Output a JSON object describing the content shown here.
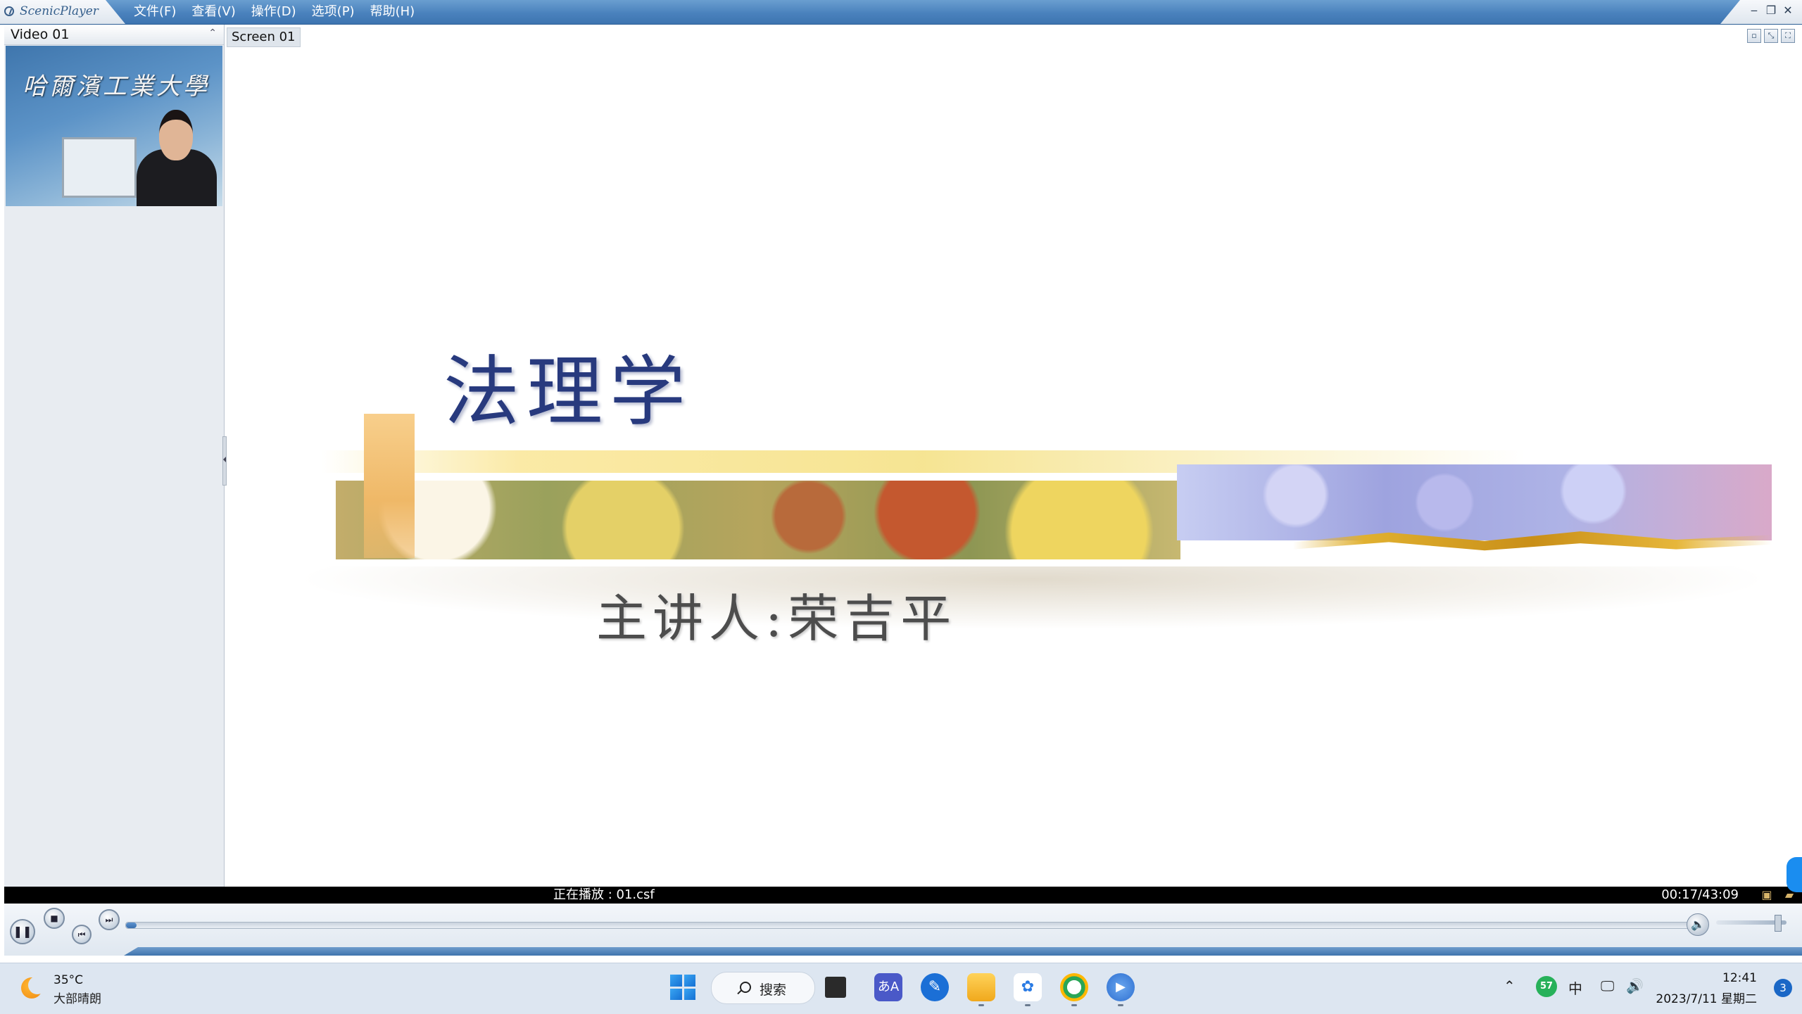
{
  "app": {
    "brand": "ScenicPlayer",
    "menu": [
      "文件(F)",
      "查看(V)",
      "操作(D)",
      "选项(P)",
      "帮助(H)"
    ],
    "window_controls": [
      "minimize-icon",
      "restore-icon",
      "close-icon"
    ]
  },
  "video_panel": {
    "title": "Video 01",
    "thumbnail_caption": "哈爾濱工業大學"
  },
  "screen": {
    "tab_label": "Screen 01",
    "slide": {
      "title": "法理学",
      "presenter": "主讲人:荣吉平"
    }
  },
  "status": {
    "now_playing": "正在播放 : 01.csf",
    "time": "00:17/43:09"
  },
  "playback": {
    "state": "playing",
    "seek_fraction": 0.0066,
    "volume_fraction": 0.9,
    "colors": {
      "accent": "#3f74ad",
      "titlebar": "#4a82bd",
      "status_bar": "#000000"
    }
  },
  "taskbar": {
    "weather": {
      "temp": "35°C",
      "desc": "大部晴朗"
    },
    "search_label": "搜索",
    "apps": [
      "file-explorer-icon",
      "translate-icon",
      "pen-icon",
      "folder-icon",
      "baidu-netdisk-icon",
      "edge-browser-icon",
      "media-player-icon"
    ],
    "tray": {
      "ime": "中",
      "time": "12:41",
      "date": "2023/7/11 星期二",
      "notifications": "3"
    }
  }
}
